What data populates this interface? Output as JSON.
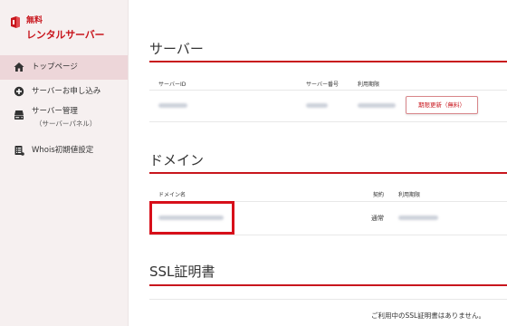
{
  "brand": {
    "line1": "無料",
    "line2": "レンタルサーバー",
    "color": "#c8161d"
  },
  "sidebar": {
    "items": [
      {
        "label": "トップページ",
        "icon": "home-icon",
        "active": true
      },
      {
        "label": "サーバーお申し込み",
        "icon": "plus-circle-icon",
        "active": false
      },
      {
        "label": "サーバー管理",
        "sublabel": "（サーバーパネル）",
        "icon": "server-icon",
        "active": false
      },
      {
        "label": "Whois初期値設定",
        "icon": "document-list-icon",
        "active": false
      }
    ]
  },
  "server_section": {
    "title": "サーバー",
    "headers": {
      "server_id": "サーバーID",
      "server_number": "サーバー番号",
      "expiry": "利用期限"
    },
    "renew_button": "期限更新（無料）"
  },
  "domain_section": {
    "title": "ドメイン",
    "headers": {
      "domain_name": "ドメイン名",
      "contract": "契約",
      "expiry": "利用期限"
    },
    "contract_value": "通常"
  },
  "ssl_section": {
    "title": "SSL証明書",
    "empty_message": "ご利用中のSSL証明書はありません。"
  },
  "colors": {
    "accent": "#c8161d",
    "sidebar_bg": "#f6f0f0",
    "active_item_bg": "#edd6d9"
  }
}
